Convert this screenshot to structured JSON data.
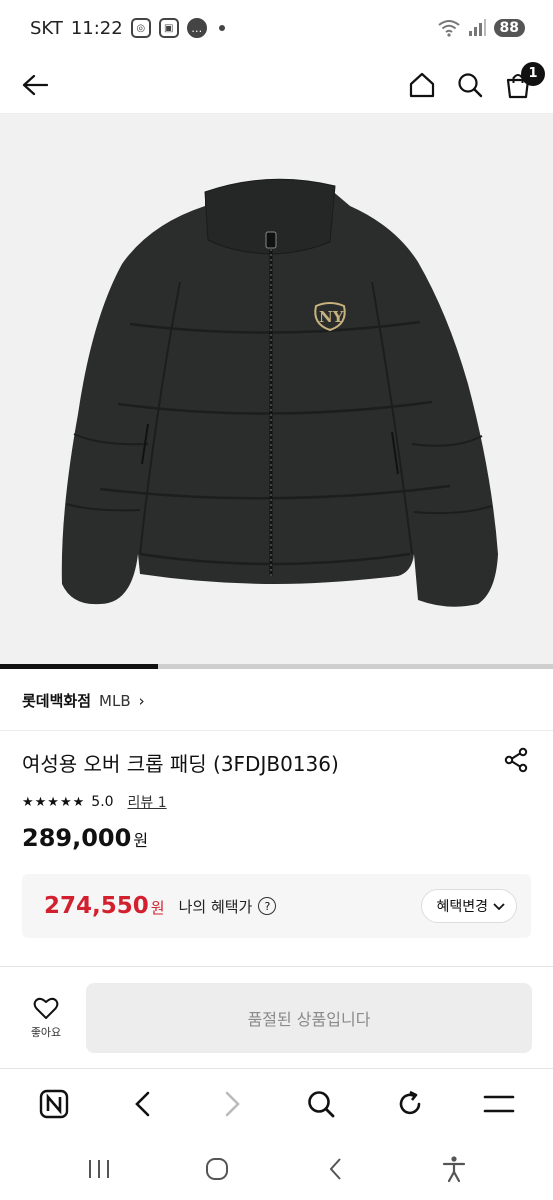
{
  "status_bar": {
    "carrier": "SKT",
    "time": "11:22",
    "battery": "88"
  },
  "header": {
    "cart_count": "1"
  },
  "product": {
    "image_progress_fraction": 0.285,
    "store": "롯데백화점",
    "brand": "MLB",
    "brand_chevron": "›",
    "title": "여성용 오버 크롭 패딩 (3FDJB0136)",
    "stars": "★★★★★",
    "rating": "5.0",
    "review_label": "리뷰 1",
    "price": "289,000",
    "price_unit": "원"
  },
  "benefit": {
    "price": "274,550",
    "price_unit": "원",
    "label": "나의 혜택가",
    "help": "?",
    "change_label": "혜택변경"
  },
  "actions": {
    "like_label": "좋아요",
    "soldout_label": "품절된 상품입니다"
  },
  "colors": {
    "accent_red": "#d3202f",
    "soldout_bg": "#ededed",
    "jacket": "#2b2d2d"
  }
}
